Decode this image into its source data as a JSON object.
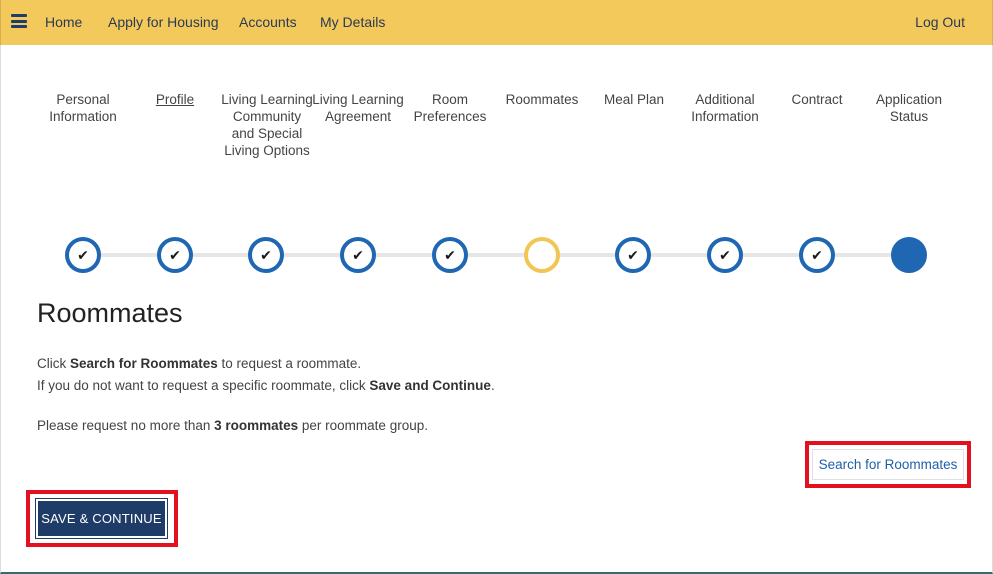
{
  "nav": {
    "home": "Home",
    "apply": "Apply for Housing",
    "accounts": "Accounts",
    "details": "My Details",
    "logout": "Log Out",
    "menu_icon": "hamburger-menu-icon"
  },
  "steps": [
    {
      "label": "Personal Information",
      "status": "complete"
    },
    {
      "label": "Profile",
      "status": "complete"
    },
    {
      "label": "Living Learning Community and Special Living Options",
      "status": "complete"
    },
    {
      "label": "Living Learning Agreement",
      "status": "complete"
    },
    {
      "label": "Room Preferences",
      "status": "complete"
    },
    {
      "label": "Roommates",
      "status": "current"
    },
    {
      "label": "Meal Plan",
      "status": "complete"
    },
    {
      "label": "Additional Information",
      "status": "complete"
    },
    {
      "label": "Contract",
      "status": "complete"
    },
    {
      "label": "Application Status",
      "status": "filled"
    }
  ],
  "check_glyph": "✔",
  "page": {
    "title": "Roommates",
    "line1_pre": "Click ",
    "line1_bold": "Search for Roommates",
    "line1_post": " to request a roommate.",
    "line2_pre": "If you do not want to request a specific roommate, click ",
    "line2_bold": "Save and Continue",
    "line2_post": ".",
    "line3_pre": "Please request no more than ",
    "line3_bold": "3 roommates",
    "line3_post": " per roommate group."
  },
  "actions": {
    "search_label": "Search for Roommates",
    "save_label": "SAVE & CONTINUE"
  },
  "colors": {
    "topbar": "#f3c95b",
    "accent_blue": "#1f66b3",
    "current_step": "#f2c654",
    "button_navy": "#1f3b67",
    "highlight_red": "#e3101d"
  }
}
